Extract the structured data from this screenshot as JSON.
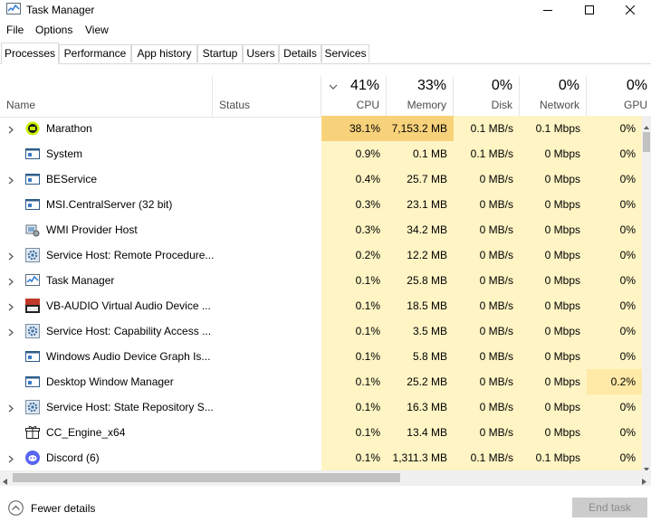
{
  "window": {
    "title": "Task Manager"
  },
  "menu": [
    "File",
    "Options",
    "View"
  ],
  "tabs": [
    "Processes",
    "Performance",
    "App history",
    "Startup",
    "Users",
    "Details",
    "Services"
  ],
  "header": {
    "name": "Name",
    "status": "Status",
    "cpu": {
      "pct": "41%",
      "label": "CPU"
    },
    "memory": {
      "pct": "33%",
      "label": "Memory"
    },
    "disk": {
      "pct": "0%",
      "label": "Disk"
    },
    "network": {
      "pct": "0%",
      "label": "Network"
    },
    "gpu": {
      "pct": "0%",
      "label": "GPU"
    }
  },
  "processes": [
    {
      "name": "Marathon",
      "expandable": true,
      "icon": "marathon-icon",
      "cpu": "38.1%",
      "memory": "7,153.2 MB",
      "disk": "0.1 MB/s",
      "network": "0.1 Mbps",
      "gpu": "0%"
    },
    {
      "name": "System",
      "expandable": false,
      "icon": "window-app-icon",
      "cpu": "0.9%",
      "memory": "0.1 MB",
      "disk": "0.1 MB/s",
      "network": "0 Mbps",
      "gpu": "0%"
    },
    {
      "name": "BEService",
      "expandable": true,
      "icon": "window-app-icon",
      "cpu": "0.4%",
      "memory": "25.7 MB",
      "disk": "0 MB/s",
      "network": "0 Mbps",
      "gpu": "0%"
    },
    {
      "name": "MSI.CentralServer (32 bit)",
      "expandable": false,
      "icon": "window-app-icon",
      "cpu": "0.3%",
      "memory": "23.1 MB",
      "disk": "0 MB/s",
      "network": "0 Mbps",
      "gpu": "0%"
    },
    {
      "name": "WMI Provider Host",
      "expandable": false,
      "icon": "wmi-icon",
      "cpu": "0.3%",
      "memory": "34.2 MB",
      "disk": "0 MB/s",
      "network": "0 Mbps",
      "gpu": "0%"
    },
    {
      "name": "Service Host: Remote Procedure...",
      "expandable": true,
      "icon": "gear-icon",
      "cpu": "0.2%",
      "memory": "12.2 MB",
      "disk": "0 MB/s",
      "network": "0 Mbps",
      "gpu": "0%"
    },
    {
      "name": "Task Manager",
      "expandable": true,
      "icon": "task-manager-icon",
      "cpu": "0.1%",
      "memory": "25.8 MB",
      "disk": "0 MB/s",
      "network": "0 Mbps",
      "gpu": "0%"
    },
    {
      "name": "VB-AUDIO Virtual Audio Device ...",
      "expandable": true,
      "icon": "voicemeeter-icon",
      "cpu": "0.1%",
      "memory": "18.5 MB",
      "disk": "0 MB/s",
      "network": "0 Mbps",
      "gpu": "0%"
    },
    {
      "name": "Service Host: Capability Access ...",
      "expandable": true,
      "icon": "gear-icon",
      "cpu": "0.1%",
      "memory": "3.5 MB",
      "disk": "0 MB/s",
      "network": "0 Mbps",
      "gpu": "0%"
    },
    {
      "name": "Windows Audio Device Graph Is...",
      "expandable": false,
      "icon": "window-app-icon",
      "cpu": "0.1%",
      "memory": "5.8 MB",
      "disk": "0 MB/s",
      "network": "0 Mbps",
      "gpu": "0%"
    },
    {
      "name": "Desktop Window Manager",
      "expandable": false,
      "icon": "window-app-icon",
      "cpu": "0.1%",
      "memory": "25.2 MB",
      "disk": "0 MB/s",
      "network": "0 Mbps",
      "gpu": "0.2%"
    },
    {
      "name": "Service Host: State Repository S...",
      "expandable": true,
      "icon": "gear-icon",
      "cpu": "0.1%",
      "memory": "16.3 MB",
      "disk": "0 MB/s",
      "network": "0 Mbps",
      "gpu": "0%"
    },
    {
      "name": "CC_Engine_x64",
      "expandable": false,
      "icon": "gift-icon",
      "cpu": "0.1%",
      "memory": "13.4 MB",
      "disk": "0 MB/s",
      "network": "0 Mbps",
      "gpu": "0%"
    },
    {
      "name": "Discord (6)",
      "expandable": true,
      "icon": "discord-icon",
      "cpu": "0.1%",
      "memory": "1,311.3 MB",
      "disk": "0.1 MB/s",
      "network": "0.1 Mbps",
      "gpu": "0%"
    }
  ],
  "footer": {
    "fewer_details": "Fewer details",
    "end_task": "End task"
  },
  "colors": {
    "heat_high": "#f8d27a",
    "heat_low": "#fff4c4",
    "heat_mid": "#ffe9a6",
    "tab_border": "#d9d9d9"
  }
}
